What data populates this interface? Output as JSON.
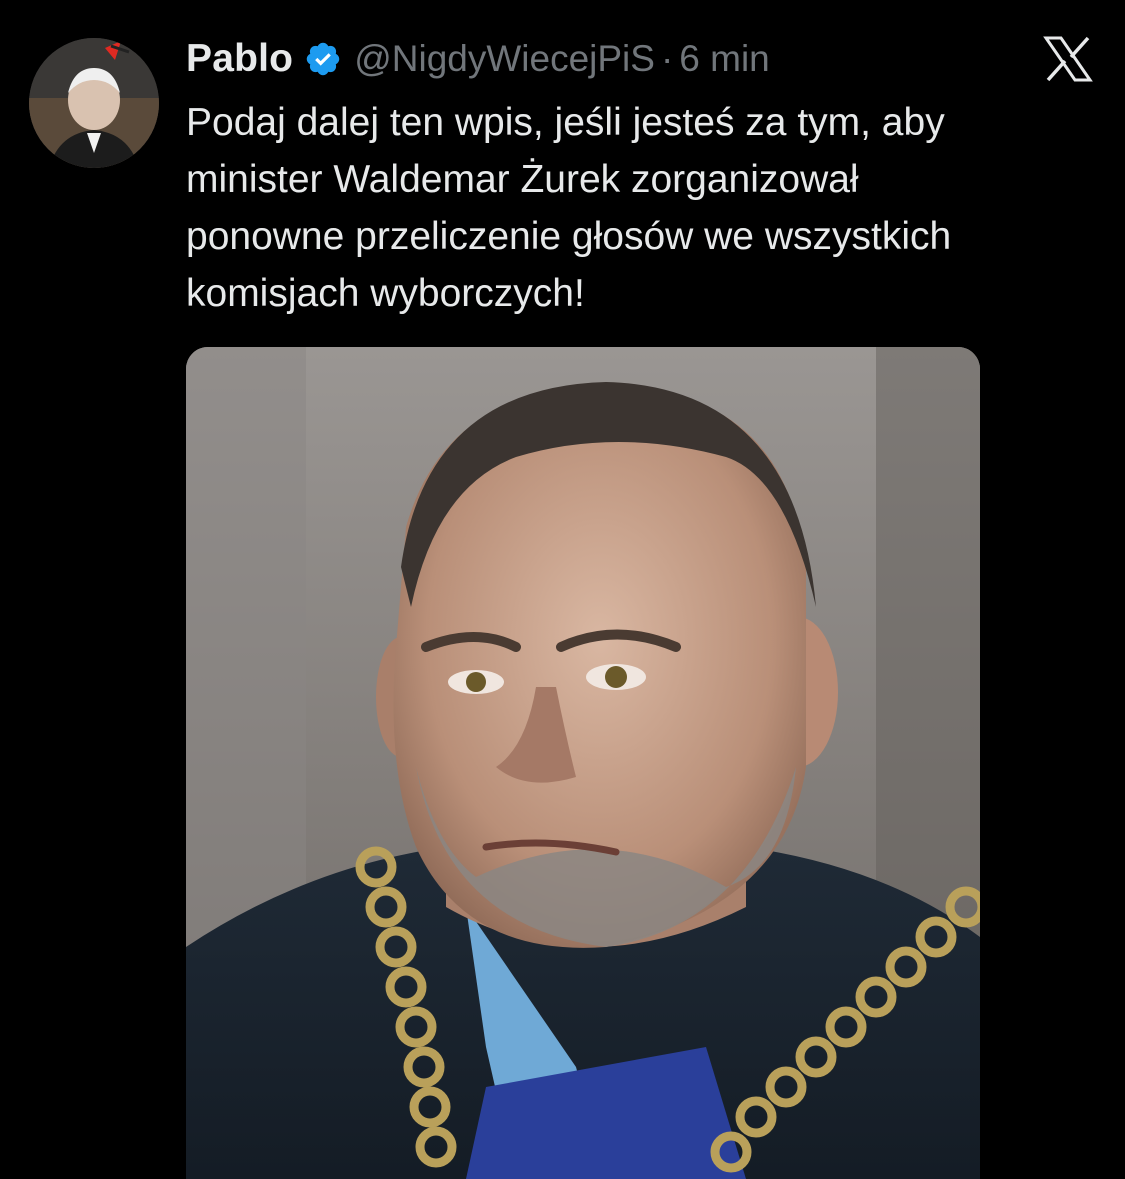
{
  "tweet": {
    "display_name": "Pablo",
    "verified_icon": "verified-badge-icon",
    "handle": "@NigdyWiecejPiS",
    "separator": "·",
    "timestamp": "6 min",
    "text": "Podaj dalej ten wpis, jeśli jesteś za tym, aby\nminister Waldemar Żurek zorganizował\nponowne przeliczenie głosów we wszystkich\nkomisjach wyborczych!",
    "platform_icon": "x-logo-icon",
    "media_description_icon": "photo"
  },
  "colors": {
    "background": "#000000",
    "text_primary": "#e7e9ea",
    "text_secondary": "#71767b",
    "verified_blue": "#1d9bf0"
  }
}
